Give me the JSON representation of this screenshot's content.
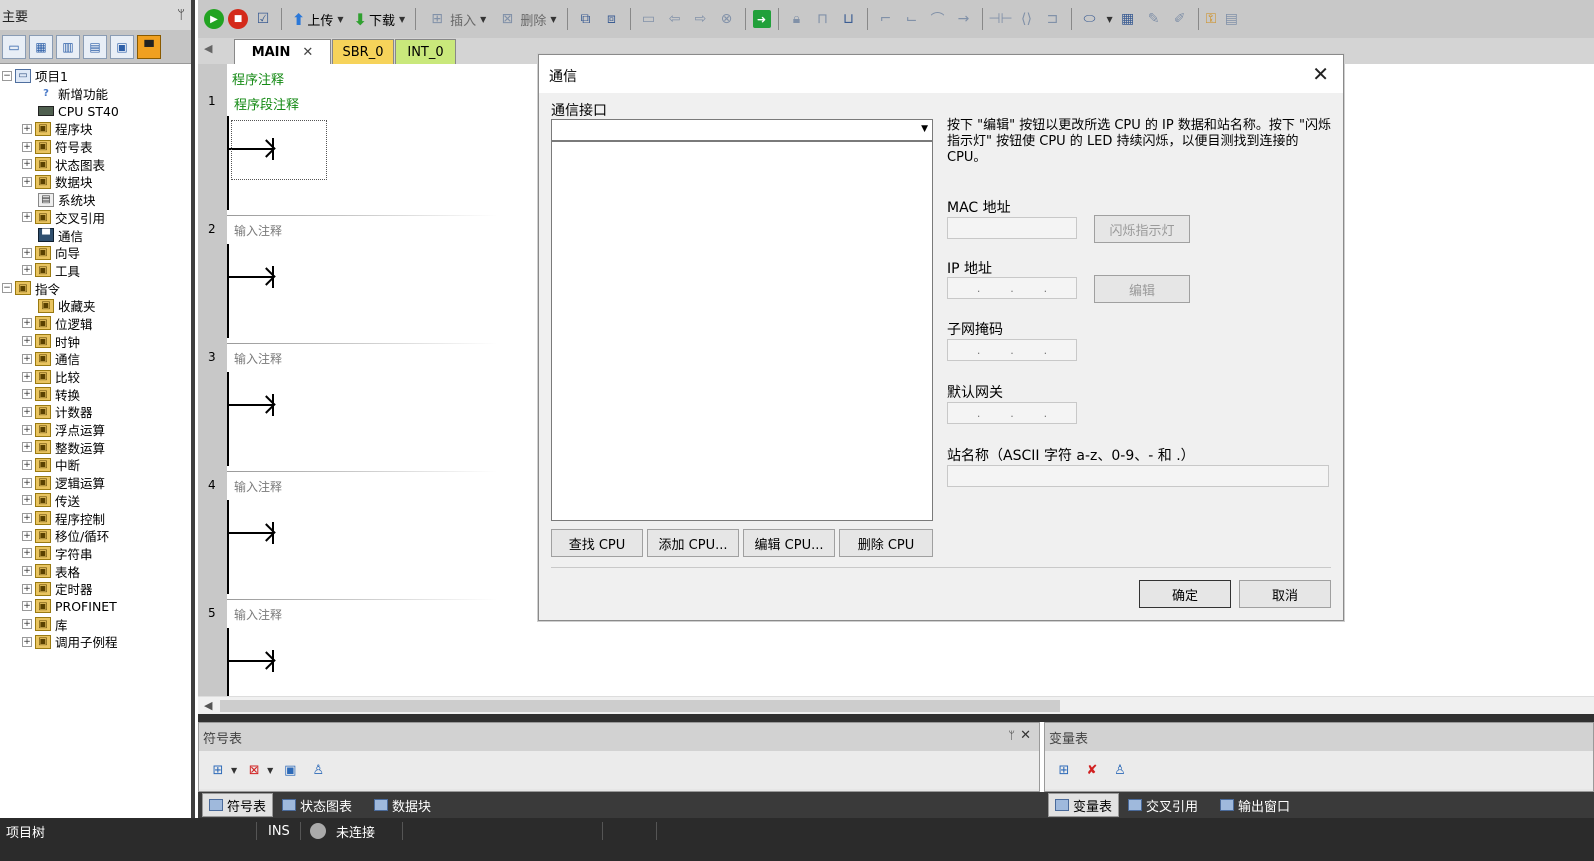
{
  "sidebar": {
    "title": "主要",
    "pin": "ᛘ",
    "tree": [
      {
        "label": "项目1",
        "indent": 0,
        "toggle": "⊟",
        "icon": "proj"
      },
      {
        "label": "新增功能",
        "indent": 2,
        "toggle": "",
        "icon": "help"
      },
      {
        "label": "CPU ST40",
        "indent": 2,
        "toggle": "",
        "icon": "cpu"
      },
      {
        "label": "程序块",
        "indent": 1,
        "toggle": "+",
        "icon": "folder"
      },
      {
        "label": "符号表",
        "indent": 1,
        "toggle": "+",
        "icon": "folder"
      },
      {
        "label": "状态图表",
        "indent": 1,
        "toggle": "+",
        "icon": "folder"
      },
      {
        "label": "数据块",
        "indent": 1,
        "toggle": "+",
        "icon": "folder"
      },
      {
        "label": "系统块",
        "indent": 2,
        "toggle": "",
        "icon": "plain"
      },
      {
        "label": "交叉引用",
        "indent": 1,
        "toggle": "+",
        "icon": "folder"
      },
      {
        "label": "通信",
        "indent": 2,
        "toggle": "",
        "icon": "comm"
      },
      {
        "label": "向导",
        "indent": 1,
        "toggle": "+",
        "icon": "folder"
      },
      {
        "label": "工具",
        "indent": 1,
        "toggle": "+",
        "icon": "folder"
      },
      {
        "label": "指令",
        "indent": 0,
        "toggle": "⊟",
        "icon": "folder"
      },
      {
        "label": "收藏夹",
        "indent": 2,
        "toggle": "",
        "icon": "folder"
      },
      {
        "label": "位逻辑",
        "indent": 1,
        "toggle": "+",
        "icon": "folder"
      },
      {
        "label": "时钟",
        "indent": 1,
        "toggle": "+",
        "icon": "folder"
      },
      {
        "label": "通信",
        "indent": 1,
        "toggle": "+",
        "icon": "folder"
      },
      {
        "label": "比较",
        "indent": 1,
        "toggle": "+",
        "icon": "folder"
      },
      {
        "label": "转换",
        "indent": 1,
        "toggle": "+",
        "icon": "folder"
      },
      {
        "label": "计数器",
        "indent": 1,
        "toggle": "+",
        "icon": "folder"
      },
      {
        "label": "浮点运算",
        "indent": 1,
        "toggle": "+",
        "icon": "folder"
      },
      {
        "label": "整数运算",
        "indent": 1,
        "toggle": "+",
        "icon": "folder"
      },
      {
        "label": "中断",
        "indent": 1,
        "toggle": "+",
        "icon": "folder"
      },
      {
        "label": "逻辑运算",
        "indent": 1,
        "toggle": "+",
        "icon": "folder"
      },
      {
        "label": "传送",
        "indent": 1,
        "toggle": "+",
        "icon": "folder"
      },
      {
        "label": "程序控制",
        "indent": 1,
        "toggle": "+",
        "icon": "folder"
      },
      {
        "label": "移位/循环",
        "indent": 1,
        "toggle": "+",
        "icon": "folder"
      },
      {
        "label": "字符串",
        "indent": 1,
        "toggle": "+",
        "icon": "folder"
      },
      {
        "label": "表格",
        "indent": 1,
        "toggle": "+",
        "icon": "folder"
      },
      {
        "label": "定时器",
        "indent": 1,
        "toggle": "+",
        "icon": "folder"
      },
      {
        "label": "PROFINET",
        "indent": 1,
        "toggle": "+",
        "icon": "folder"
      },
      {
        "label": "库",
        "indent": 1,
        "toggle": "+",
        "icon": "folder"
      },
      {
        "label": "调用子例程",
        "indent": 1,
        "toggle": "+",
        "icon": "folder"
      }
    ]
  },
  "toolbar": {
    "upload_label": "上传",
    "download_label": "下载",
    "insert_label": "插入",
    "delete_label": "删除"
  },
  "tabs": {
    "main": "MAIN",
    "close": "✕",
    "sbr": "SBR_0",
    "int": "INT_0"
  },
  "editor": {
    "program_comment": "程序注释",
    "networks": [
      {
        "number": "1",
        "comment": "程序段注释"
      },
      {
        "number": "2",
        "comment": "输入注释"
      },
      {
        "number": "3",
        "comment": "输入注释"
      },
      {
        "number": "4",
        "comment": "输入注释"
      },
      {
        "number": "5",
        "comment": "输入注释"
      }
    ]
  },
  "panels": {
    "symbols_title": "符号表",
    "vars_title": "变量表",
    "pin": "ᛘ",
    "close": "✕"
  },
  "bottom_tabs": {
    "symbols": "符号表",
    "status_chart": "状态图表",
    "data_block": "数据块",
    "var_table": "变量表",
    "cross_ref": "交叉引用",
    "output": "输出窗口"
  },
  "statusbar": {
    "project_tree": "项目树",
    "mode": "INS",
    "connection": "未连接"
  },
  "dialog": {
    "title": "通信",
    "close": "✕",
    "interface_label": "通信接口",
    "interface_value": "",
    "info_text": "按下 \"编辑\" 按钮以更改所选 CPU 的 IP 数据和站名称。按下 \"闪烁指示灯\" 按钮使 CPU 的 LED 持续闪烁，以便目测找到连接的 CPU。",
    "mac_label": "MAC 地址",
    "flash_button": "闪烁指示灯",
    "ip_label": "IP 地址",
    "edit_button": "编辑",
    "subnet_label": "子网掩码",
    "gateway_label": "默认网关",
    "station_label": "站名称（ASCII 字符 a-z、0-9、- 和 .）",
    "ip_dot": ".",
    "find_button": "查找 CPU",
    "add_button": "添加 CPU...",
    "edit_cpu_button": "编辑 CPU...",
    "delete_cpu_button": "删除 CPU",
    "ok_button": "确定",
    "cancel_button": "取消"
  }
}
